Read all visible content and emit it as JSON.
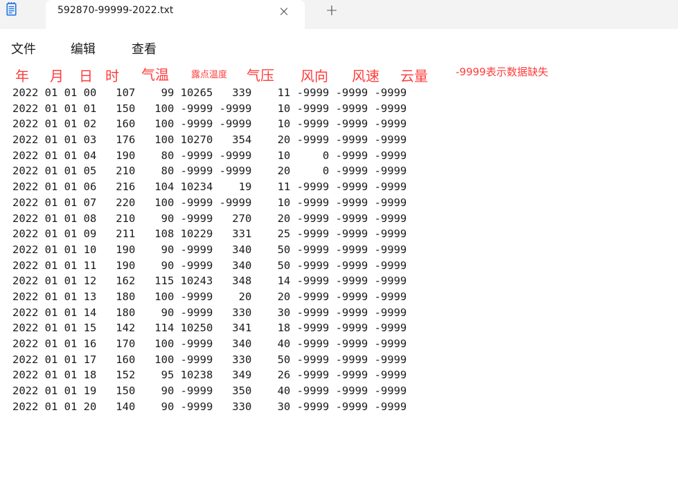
{
  "tab": {
    "title": "592870-99999-2022.txt",
    "close_glyph": "×",
    "new_tab_glyph": "+"
  },
  "menu": {
    "file": "文件",
    "edit": "编辑",
    "view": "查看"
  },
  "annotations": {
    "year": "年",
    "month": "月",
    "day": "日",
    "hour": "时",
    "temp": "气温",
    "dewpoint": "露点温度",
    "pressure": "气压",
    "wind_dir": "风向",
    "wind_speed": "风速",
    "cloud": "云量",
    "missing_note": "-9999表示数据缺失"
  },
  "lines": [
    "2022 01 01 00   107    99 10265   339    11 -9999 -9999 -9999",
    "2022 01 01 01   150   100 -9999 -9999    10 -9999 -9999 -9999",
    "2022 01 01 02   160   100 -9999 -9999    10 -9999 -9999 -9999",
    "2022 01 01 03   176   100 10270   354    20 -9999 -9999 -9999",
    "2022 01 01 04   190    80 -9999 -9999    10     0 -9999 -9999",
    "2022 01 01 05   210    80 -9999 -9999    20     0 -9999 -9999",
    "2022 01 01 06   216   104 10234    19    11 -9999 -9999 -9999",
    "2022 01 01 07   220   100 -9999 -9999    10 -9999 -9999 -9999",
    "2022 01 01 08   210    90 -9999   270    20 -9999 -9999 -9999",
    "2022 01 01 09   211   108 10229   331    25 -9999 -9999 -9999",
    "2022 01 01 10   190    90 -9999   340    50 -9999 -9999 -9999",
    "2022 01 01 11   190    90 -9999   340    50 -9999 -9999 -9999",
    "2022 01 01 12   162   115 10243   348    14 -9999 -9999 -9999",
    "2022 01 01 13   180   100 -9999    20    20 -9999 -9999 -9999",
    "2022 01 01 14   180    90 -9999   330    30 -9999 -9999 -9999",
    "2022 01 01 15   142   114 10250   341    18 -9999 -9999 -9999",
    "2022 01 01 16   170   100 -9999   340    40 -9999 -9999 -9999",
    "2022 01 01 17   160   100 -9999   330    50 -9999 -9999 -9999",
    "2022 01 01 18   152    95 10238   349    26 -9999 -9999 -9999",
    "2022 01 01 19   150    90 -9999   350    40 -9999 -9999 -9999",
    "2022 01 01 20   140    90 -9999   330    30 -9999 -9999 -9999"
  ]
}
